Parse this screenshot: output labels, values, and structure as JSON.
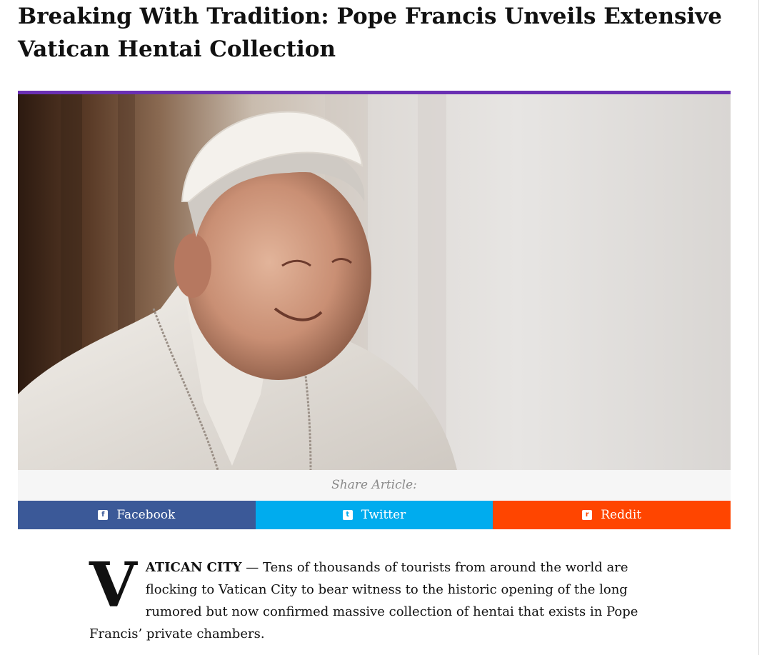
{
  "article": {
    "title": "Breaking With Tradition: Pope Francis Unveils Extensive Vatican Hentai Collection",
    "dropcap": "V",
    "dateline": "ATICAN CITY",
    "dash": " — ",
    "body": "Tens of thousands of tourists from around the world are flocking to Vatican City to bear witness to the historic opening of the long rumored but now confirmed massive collection of hentai that exists in Pope Francis’ private chambers."
  },
  "share": {
    "label": "Share Article:",
    "buttons": [
      {
        "label": "Facebook",
        "icon": "facebook-icon",
        "color": "#3b5998"
      },
      {
        "label": "Twitter",
        "icon": "twitter-icon",
        "color": "#00acee"
      },
      {
        "label": "Reddit",
        "icon": "reddit-icon",
        "color": "#ff4500"
      }
    ]
  },
  "colors": {
    "accent": "#6a2fb3"
  }
}
